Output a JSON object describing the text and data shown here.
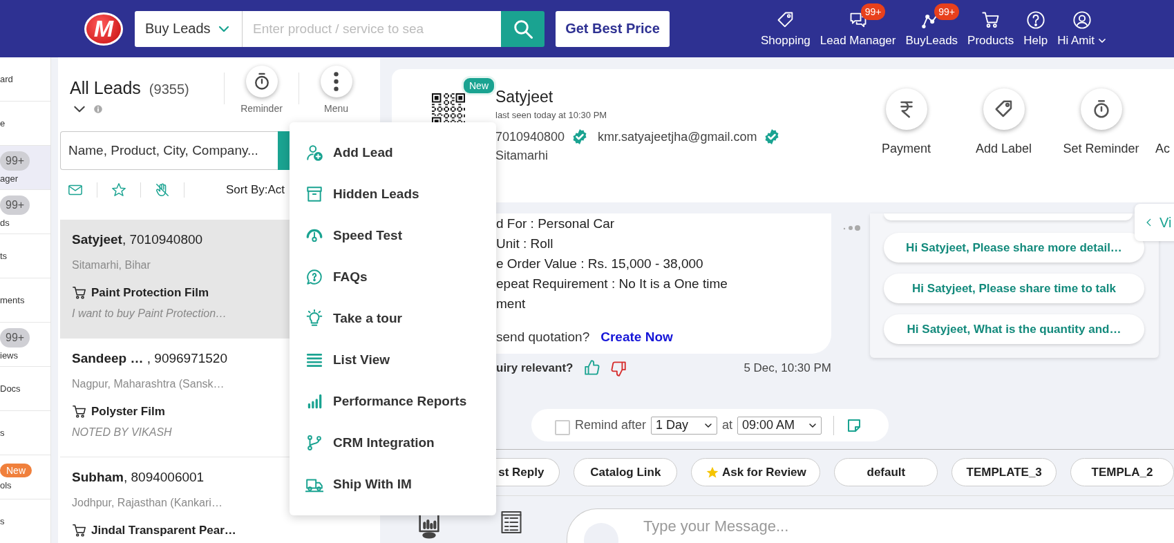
{
  "topbar": {
    "logo": "M",
    "category": "Buy Leads",
    "search_placeholder": "Enter product / service to sea",
    "best_price": "Get Best Price",
    "nav": [
      {
        "label": "Shopping",
        "kind": "tag"
      },
      {
        "label": "Lead Manager",
        "kind": "chat",
        "badge": "99+"
      },
      {
        "label": "BuyLeads",
        "kind": "graph",
        "badge": "99+"
      },
      {
        "label": "Products",
        "kind": "cart"
      },
      {
        "label": "Help",
        "kind": "help"
      },
      {
        "label": "Hi Amit",
        "kind": "account"
      }
    ]
  },
  "sidebar": {
    "items": [
      {
        "label": "ard",
        "selected": false
      },
      {
        "label": "e",
        "selected": false
      },
      {
        "label": "ager",
        "badge": "99+",
        "selected": true
      },
      {
        "label": "ds",
        "badge": "99+",
        "selected": false
      },
      {
        "label": "ts",
        "selected": false
      },
      {
        "label": "ments",
        "selected": false
      },
      {
        "label": "iews",
        "badge": "99+",
        "selected": false
      },
      {
        "label": "Docs",
        "selected": false
      },
      {
        "label": "s",
        "selected": false
      },
      {
        "label": "ols",
        "tag": "New",
        "selected": false
      },
      {
        "label": "s",
        "selected": false
      }
    ]
  },
  "leads_panel": {
    "title": "All Leads",
    "count": "(9355)",
    "actions": [
      {
        "label": "Reminder",
        "kind": "timer"
      },
      {
        "label": "Menu",
        "kind": "dots"
      }
    ],
    "search_placeholder": "Name, Product, City, Company...",
    "sort": "Sort By:Act",
    "leads": [
      {
        "title": "**Satyjeet**, 7010940800",
        "location": "Sitamarhi, Bihar",
        "product": "Paint Protection Film",
        "note": "I want to buy Paint Protection…",
        "selected": true
      },
      {
        "title": "**Sandeep …** , 9096971520",
        "location": "Nagpur, Maharashtra (Sansk…",
        "product": "Polyster Film",
        "note": "NOTED BY VIKASH",
        "selected": false
      },
      {
        "title": "**Subham**, 8094006001",
        "location": "Jodhpur, Rajasthan (Kankari…",
        "product": "Jindal Transparent Pear…",
        "selected": false
      }
    ]
  },
  "menu": {
    "items": [
      {
        "label": "Add Lead",
        "kind": "adduser"
      },
      {
        "label": "Hidden Leads",
        "kind": "archive"
      },
      {
        "label": "Speed Test",
        "kind": "gauge"
      },
      {
        "label": "FAQs",
        "kind": "faq"
      },
      {
        "label": "Take a tour",
        "kind": "bulb"
      },
      {
        "label": "List View",
        "kind": "list"
      },
      {
        "label": "Performance Reports",
        "kind": "bars"
      },
      {
        "label": "CRM Integration",
        "kind": "branch"
      },
      {
        "label": "Ship With IM",
        "kind": "truck"
      }
    ]
  },
  "contact": {
    "badge": "New",
    "name": "Satyjeet",
    "last_seen": "last seen today at 10:30 PM",
    "phone": "7010940800",
    "phone_verified": true,
    "email": "kmr.satyajeetjha@gmail.com",
    "email_verified": true,
    "city": "Sitamarhi",
    "actions": [
      {
        "label": "Payment",
        "kind": "rupee"
      },
      {
        "label": "Add Label",
        "kind": "tag"
      },
      {
        "label": "Set Reminder",
        "kind": "timer"
      },
      {
        "label": "Ac",
        "kind": "blank"
      }
    ]
  },
  "enquiry": {
    "lines": [
      "d For : Personal Car",
      "Unit : Roll",
      "e Order Value : Rs. 15,000 - 38,000",
      "epeat Requirement : No It is a One time",
      "ment"
    ],
    "quote_prompt": "send quotation?",
    "quote_link": "Create Now",
    "relevance_prompt": "uiry relevant?",
    "time": "5 Dec, 10:30 PM"
  },
  "suggestions": [
    "Hi Satyjeet, Please share more detail…",
    "Hi Satyjeet, Please share time to talk",
    "Hi Satyjeet, What is the quantity and…"
  ],
  "view_tab": "Vi",
  "reminder": {
    "checked": false,
    "label": "Remind after",
    "period": "1 Day",
    "at": "at",
    "time": "09:00 AM"
  },
  "templates": [
    {
      "label": "st Reply",
      "starred": false
    },
    {
      "label": "Catalog Link",
      "starred": false
    },
    {
      "label": "Ask for Review",
      "starred": true
    },
    {
      "label": "default",
      "starred": false
    },
    {
      "label": "TEMPLATE_3",
      "starred": false
    },
    {
      "label": "TEMPLA_2",
      "starred": false
    }
  ],
  "composer": {
    "placeholder": "Type your Message..."
  }
}
